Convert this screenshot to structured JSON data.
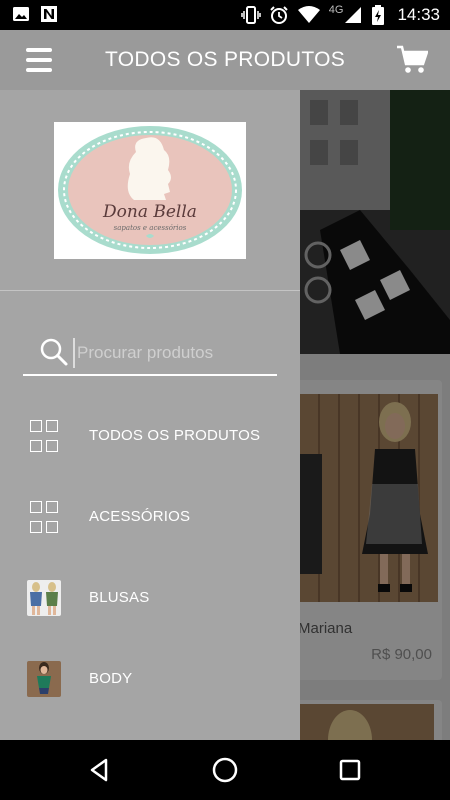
{
  "status_bar": {
    "network": "4G",
    "time": "14:33",
    "icons": [
      "image-icon",
      "n-app-icon",
      "vibrate-icon",
      "alarm-icon",
      "wifi-icon",
      "signal-icon",
      "battery-charging-icon"
    ]
  },
  "app_bar": {
    "title": "TODOS OS PRODUTOS",
    "menu_icon": "hamburger-icon",
    "cart_icon": "cart-icon"
  },
  "drawer": {
    "logo": {
      "brand": "Dona Bella",
      "tagline": "sapatos e acessórios"
    },
    "search": {
      "placeholder": "Procurar produtos",
      "value": ""
    },
    "items": [
      {
        "label": "TODOS OS PRODUTOS",
        "icon": "grid-icon"
      },
      {
        "label": "ACESSÓRIOS",
        "icon": "grid-icon"
      },
      {
        "label": "BLUSAS",
        "icon": "thumbnail"
      },
      {
        "label": "BODY",
        "icon": "thumbnail"
      }
    ]
  },
  "background": {
    "product": {
      "name": "Mariana",
      "price": "R$ 90,00"
    }
  },
  "colors": {
    "app_bar": "#9a9a9a",
    "drawer": "#a5a5a5",
    "logo_pink": "#e9c4bc",
    "logo_mint": "#a9dccd"
  }
}
